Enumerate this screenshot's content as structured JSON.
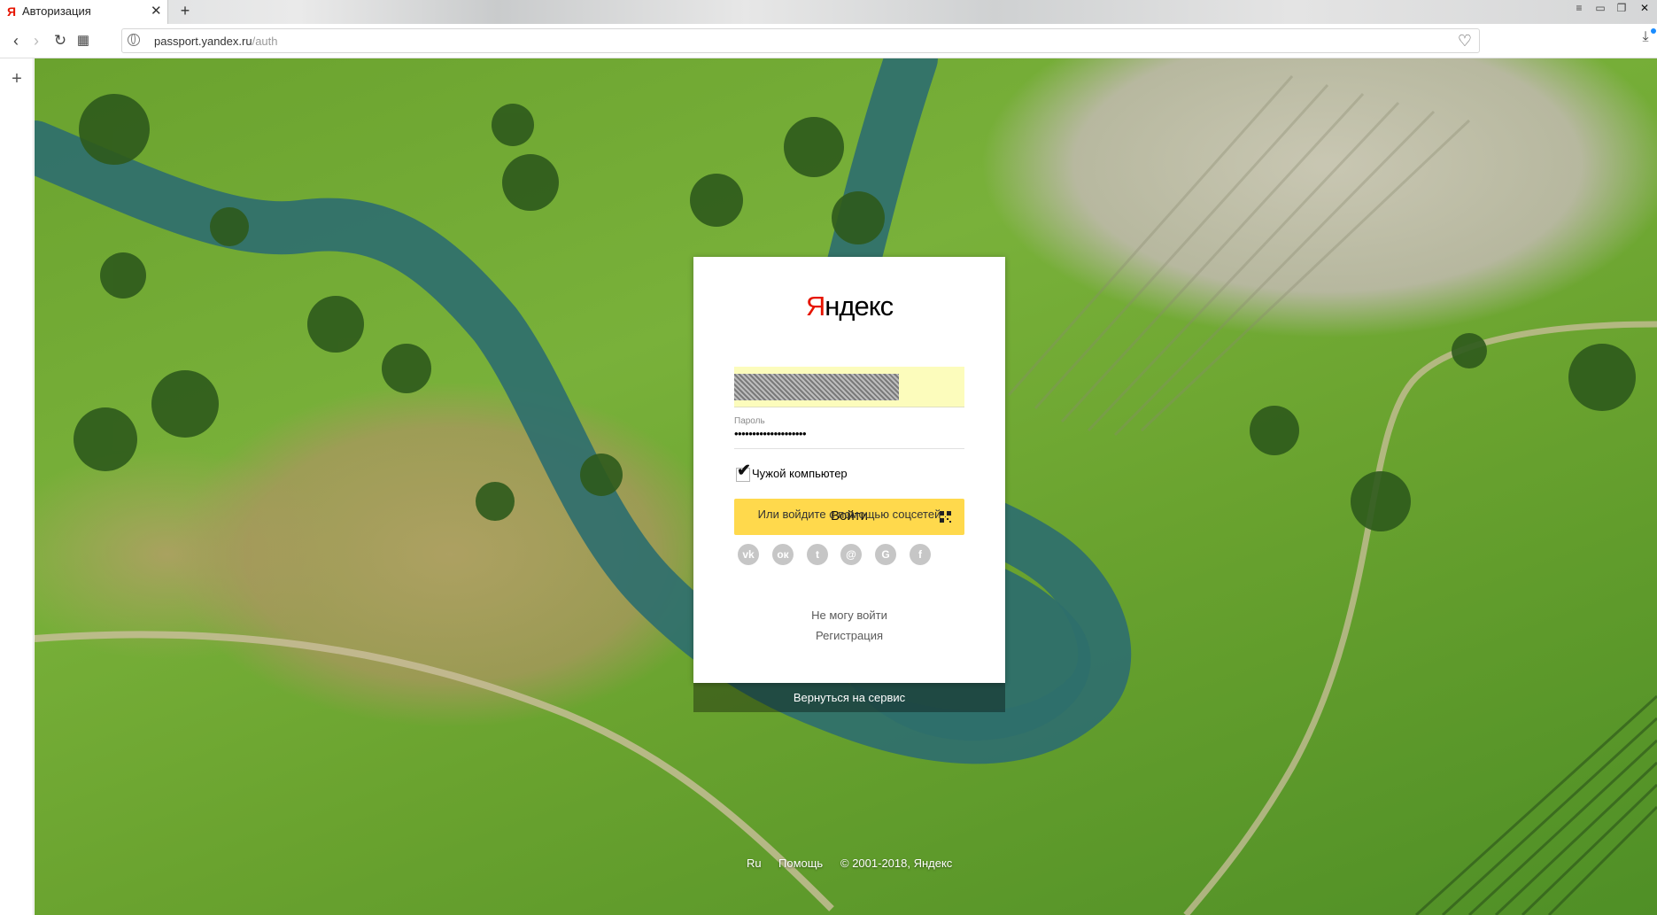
{
  "browser": {
    "tab_title": "Авторизация",
    "tab_favicon": "Я",
    "close_glyph": "✕",
    "new_tab_glyph": "+",
    "url_scheme_host": "passport.yandex.ru",
    "url_path": "/auth",
    "window_buttons": [
      "menu",
      "minimize",
      "restore",
      "close"
    ],
    "window_glyphs": [
      "≡",
      "▭",
      "❐",
      "✕"
    ]
  },
  "sidebar": {
    "add_glyph": "+"
  },
  "login": {
    "logo_first": "Я",
    "logo_rest": "ндекс",
    "login_value_redacted": true,
    "password_label": "Пароль",
    "password_value": "••••••••••••••••••••",
    "checkbox_checked": true,
    "checkbox_label": "Чужой компьютер",
    "submit_label": "Войти",
    "social_title": "Или войдите с помощью соцсетей",
    "socials": [
      {
        "name": "vk",
        "glyph": "vk"
      },
      {
        "name": "odnoklassniki",
        "glyph": "ок"
      },
      {
        "name": "twitter",
        "glyph": "t"
      },
      {
        "name": "mail",
        "glyph": "@"
      },
      {
        "name": "google",
        "glyph": "G"
      },
      {
        "name": "facebook",
        "glyph": "f"
      }
    ],
    "cant_login": "Не могу войти",
    "register": "Регистрация",
    "back_to_service": "Вернуться на сервис"
  },
  "footer": {
    "lang": "Ru",
    "help": "Помощь",
    "copyright": "© 2001-2018, Яндекс"
  },
  "colors": {
    "brand_red": "#e61400",
    "button_yellow": "#ffd94c",
    "autofill_yellow": "#fcfcbc",
    "social_grey": "#c6c6c6"
  }
}
